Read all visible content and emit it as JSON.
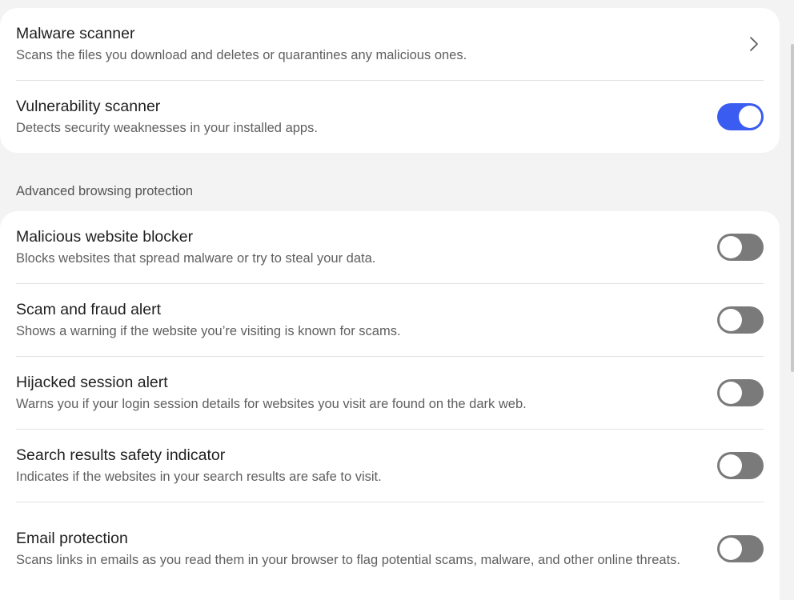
{
  "security": {
    "items": [
      {
        "title": "Malware scanner",
        "desc": "Scans the files you download and deletes or quarantines any malicious ones.",
        "control": "chevron"
      },
      {
        "title": "Vulnerability scanner",
        "desc": "Detects security weaknesses in your installed apps.",
        "control": "toggle",
        "on": true
      }
    ]
  },
  "browsing": {
    "section_label": "Advanced browsing protection",
    "items": [
      {
        "title": "Malicious website blocker",
        "desc": "Blocks websites that spread malware or try to steal your data.",
        "on": false
      },
      {
        "title": "Scam and fraud alert",
        "desc": "Shows a warning if the website you’re visiting is known for scams.",
        "on": false
      },
      {
        "title": "Hijacked session alert",
        "desc": "Warns you if your login session details for websites you visit are found on the dark web.",
        "on": false
      },
      {
        "title": "Search results safety indicator",
        "desc": "Indicates if the websites in your search results are safe to visit.",
        "on": false
      },
      {
        "title": "Email protection",
        "desc": "Scans links in emails as you read them in your browser to flag potential scams, malware, and other online threats.",
        "on": false
      }
    ]
  },
  "colors": {
    "toggle_on": "#3b5cf0",
    "toggle_off": "#7a7a7a",
    "card_bg": "#ffffff",
    "page_bg": "#f3f3f3"
  }
}
